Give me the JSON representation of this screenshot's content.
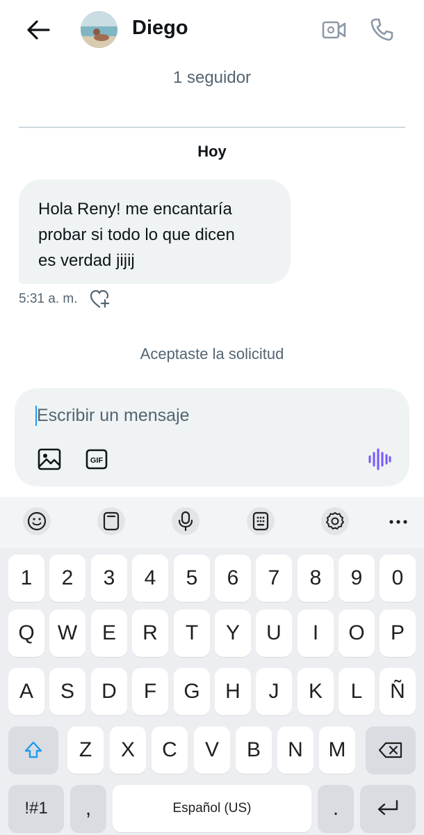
{
  "header": {
    "contact_name": "Diego",
    "followers": "1 seguidor"
  },
  "conversation": {
    "day_label": "Hoy",
    "messages": [
      {
        "text": "Hola Reny! me encantaría\nprobar si todo lo que dicen\nes verdad jijij",
        "time": "5:31 a. m."
      }
    ],
    "system_message": "Aceptaste la solicitud"
  },
  "composer": {
    "placeholder": "Escribir un mensaje",
    "value": "",
    "gif_label": "GIF",
    "voice_color": "#7856ff"
  },
  "keyboard": {
    "toolbar": [
      "emoji-icon",
      "clipboard-icon",
      "microphone-icon",
      "keypad-icon",
      "gear-icon",
      "more-icon"
    ],
    "row_numbers": [
      "1",
      "2",
      "3",
      "4",
      "5",
      "6",
      "7",
      "8",
      "9",
      "0"
    ],
    "row_1": [
      "Q",
      "W",
      "E",
      "R",
      "T",
      "Y",
      "U",
      "I",
      "O",
      "P"
    ],
    "row_2": [
      "A",
      "S",
      "D",
      "F",
      "G",
      "H",
      "J",
      "K",
      "L",
      "Ñ"
    ],
    "row_3": [
      "Z",
      "X",
      "C",
      "V",
      "B",
      "N",
      "M"
    ],
    "symbols_label": "!#1",
    "comma_label": ",",
    "space_label": "Español (US)",
    "period_label": "."
  },
  "colors": {
    "accent": "#1d9bf0",
    "text_primary": "#0f1419",
    "text_secondary": "#536471",
    "bubble_bg": "#eff3f4",
    "keyboard_bg": "#eceef1"
  }
}
